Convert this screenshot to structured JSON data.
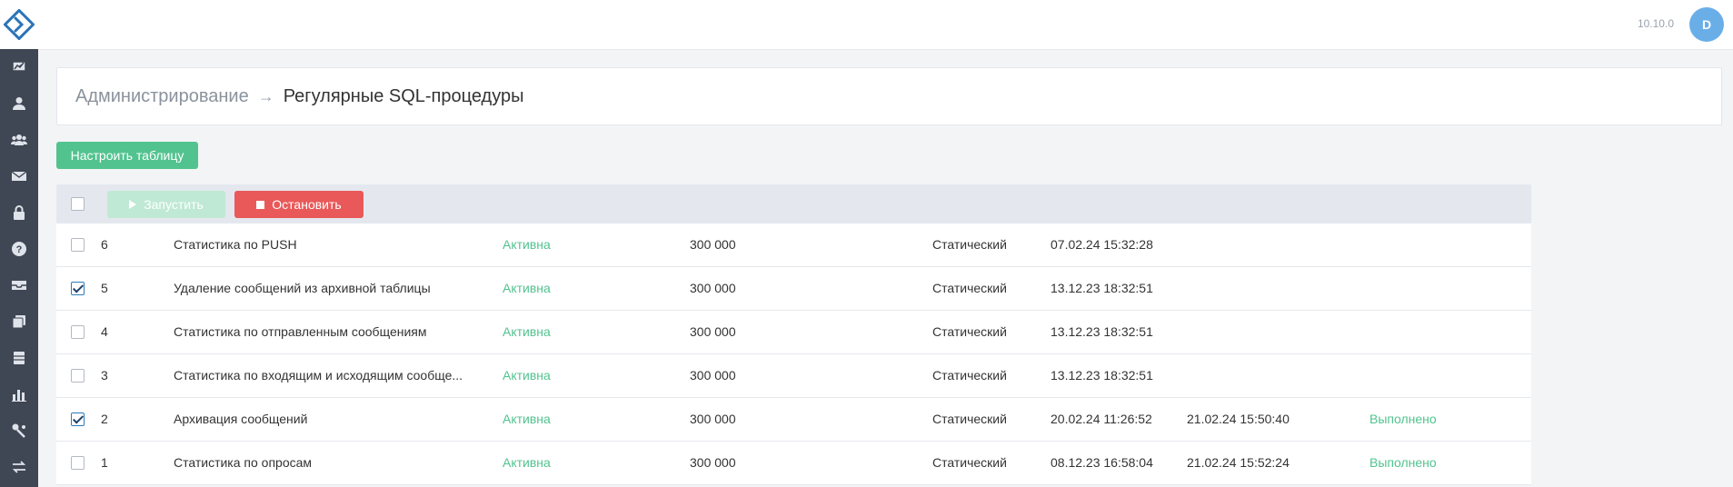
{
  "header": {
    "version": "10.10.0",
    "avatar_initial": "D"
  },
  "sidebar": {
    "icons": [
      "dashboard-icon",
      "user-icon",
      "group-icon",
      "mail-icon",
      "lock-icon",
      "help-icon",
      "inbox-icon",
      "layers-icon",
      "database-icon",
      "bar-chart-icon",
      "tools-icon",
      "transfer-icon"
    ]
  },
  "breadcrumb": {
    "parent": "Администрирование",
    "separator": "→",
    "current": "Регулярные SQL-процедуры"
  },
  "actions": {
    "configure_table": "Настроить таблицу",
    "run": "Запустить",
    "stop": "Остановить"
  },
  "colors": {
    "accent_green": "#52c38f",
    "stop_red": "#e9595a",
    "sidebar_bg": "#3f4654",
    "avatar_blue": "#6aaee8"
  },
  "rows": [
    {
      "id": "6",
      "name": "Статистика по PUSH",
      "status": "Активна",
      "interval": "300 000",
      "type": "Статический",
      "last_run": "07.02.24 15:32:28",
      "next_run": "",
      "result": "",
      "checked": false
    },
    {
      "id": "5",
      "name": "Удаление сообщений из архивной таблицы",
      "status": "Активна",
      "interval": "300 000",
      "type": "Статический",
      "last_run": "13.12.23 18:32:51",
      "next_run": "",
      "result": "",
      "checked": true
    },
    {
      "id": "4",
      "name": "Статистика по отправленным сообщениям",
      "status": "Активна",
      "interval": "300 000",
      "type": "Статический",
      "last_run": "13.12.23 18:32:51",
      "next_run": "",
      "result": "",
      "checked": false
    },
    {
      "id": "3",
      "name": "Статистика по входящим и исходящим сообще...",
      "status": "Активна",
      "interval": "300 000",
      "type": "Статический",
      "last_run": "13.12.23 18:32:51",
      "next_run": "",
      "result": "",
      "checked": false
    },
    {
      "id": "2",
      "name": "Архивация сообщений",
      "status": "Активна",
      "interval": "300 000",
      "type": "Статический",
      "last_run": "20.02.24 11:26:52",
      "next_run": "21.02.24 15:50:40",
      "result": "Выполнено",
      "checked": true
    },
    {
      "id": "1",
      "name": "Статистика по опросам",
      "status": "Активна",
      "interval": "300 000",
      "type": "Статический",
      "last_run": "08.12.23 16:58:04",
      "next_run": "21.02.24 15:52:24",
      "result": "Выполнено",
      "checked": false
    }
  ]
}
